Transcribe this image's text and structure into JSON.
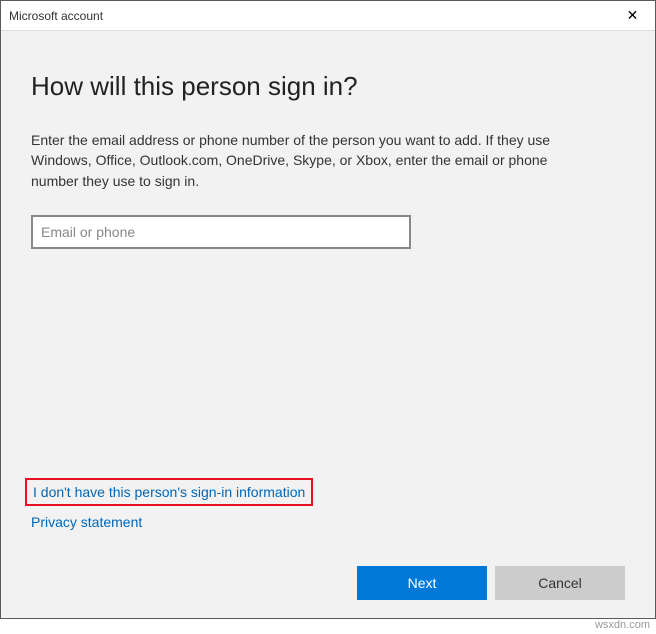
{
  "window": {
    "title": "Microsoft account",
    "close_symbol": "✕"
  },
  "main": {
    "heading": "How will this person sign in?",
    "description": "Enter the email address or phone number of the person you want to add. If they use Windows, Office, Outlook.com, OneDrive, Skype, or Xbox, enter the email or phone number they use to sign in.",
    "input_placeholder": "Email or phone",
    "input_value": ""
  },
  "links": {
    "no_info": "I don't have this person's sign-in information",
    "privacy": "Privacy statement"
  },
  "buttons": {
    "next": "Next",
    "cancel": "Cancel"
  },
  "watermark": "wsxdn.com"
}
